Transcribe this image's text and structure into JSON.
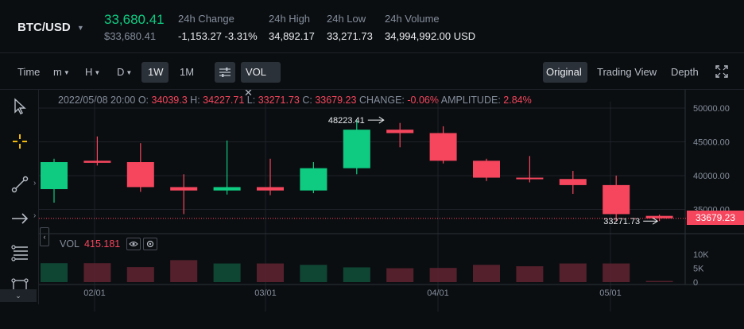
{
  "header": {
    "pair": "BTC/USD",
    "last_price": "33,680.41",
    "last_price_usd": "$33,680.41",
    "stats": [
      {
        "label": "24h Change",
        "value": "-1,153.27 -3.31%",
        "tone": "down"
      },
      {
        "label": "24h High",
        "value": "34,892.17",
        "tone": "neutral"
      },
      {
        "label": "24h Low",
        "value": "33,271.73",
        "tone": "neutral"
      },
      {
        "label": "24h Volume",
        "value": "34,994,992.00 USD",
        "tone": "neutral"
      }
    ]
  },
  "toolbar": {
    "time_label": "Time",
    "intervals": [
      "m",
      "H",
      "D",
      "1W",
      "1M"
    ],
    "active_interval": "1W",
    "indicator_tag": "VOL",
    "views": [
      "Original",
      "Trading View",
      "Depth"
    ],
    "active_view": "Original"
  },
  "ohlc_info": {
    "date": "2022/05/08 20:00",
    "o_label": "O:",
    "o": "34039.3",
    "h_label": "H:",
    "h": "34227.71",
    "l_label": "L:",
    "l": "33271.73",
    "c_label": "C:",
    "c": "33679.23",
    "change_label": "CHANGE:",
    "change": "-0.06%",
    "amplitude_label": "AMPLITUDE:",
    "amplitude": "2.84%"
  },
  "volume_info": {
    "label": "VOL",
    "value": "415.181"
  },
  "price_tag": "33679.23",
  "annotations": {
    "high_marker": "48223.41",
    "low_marker": "33271.73"
  },
  "colors": {
    "up": "#0ecb81",
    "down": "#f6465d",
    "background": "#0b0e11",
    "accent": "#f0b90b"
  },
  "chart_data": {
    "type": "candlestick",
    "y_ticks": [
      "50000.00",
      "45000.00",
      "40000.00",
      "35000.00"
    ],
    "ylim": [
      30000,
      52000
    ],
    "x_tick_labels": [
      "02/01",
      "03/01",
      "04/01",
      "05/01"
    ],
    "volume_ticks": [
      "10K",
      "5K",
      "0"
    ],
    "candles": [
      {
        "o": 38000,
        "h": 42500,
        "l": 36000,
        "c": 42000
      },
      {
        "o": 42200,
        "h": 45800,
        "l": 41500,
        "c": 41900
      },
      {
        "o": 42000,
        "h": 44800,
        "l": 37600,
        "c": 38300
      },
      {
        "o": 38300,
        "h": 40200,
        "l": 34300,
        "c": 37800
      },
      {
        "o": 37800,
        "h": 45200,
        "l": 37200,
        "c": 38300
      },
      {
        "o": 38300,
        "h": 42500,
        "l": 37100,
        "c": 37800
      },
      {
        "o": 37800,
        "h": 42000,
        "l": 37400,
        "c": 41100
      },
      {
        "o": 41100,
        "h": 48223.41,
        "l": 40200,
        "c": 46800
      },
      {
        "o": 46800,
        "h": 47800,
        "l": 44200,
        "c": 46300
      },
      {
        "o": 46300,
        "h": 47300,
        "l": 41800,
        "c": 42200
      },
      {
        "o": 42200,
        "h": 42500,
        "l": 39200,
        "c": 39700
      },
      {
        "o": 39700,
        "h": 42900,
        "l": 39000,
        "c": 39500
      },
      {
        "o": 39500,
        "h": 40700,
        "l": 37300,
        "c": 38600
      },
      {
        "o": 38600,
        "h": 40000,
        "l": 33271.73,
        "c": 34300
      },
      {
        "o": 34039.3,
        "h": 34227.71,
        "l": 33271.73,
        "c": 33679.23
      }
    ],
    "volumes": [
      6800,
      6800,
      5400,
      7900,
      6700,
      6700,
      6200,
      5300,
      5000,
      5100,
      6200,
      5700,
      6700,
      6700,
      415.181
    ],
    "grid": true
  }
}
